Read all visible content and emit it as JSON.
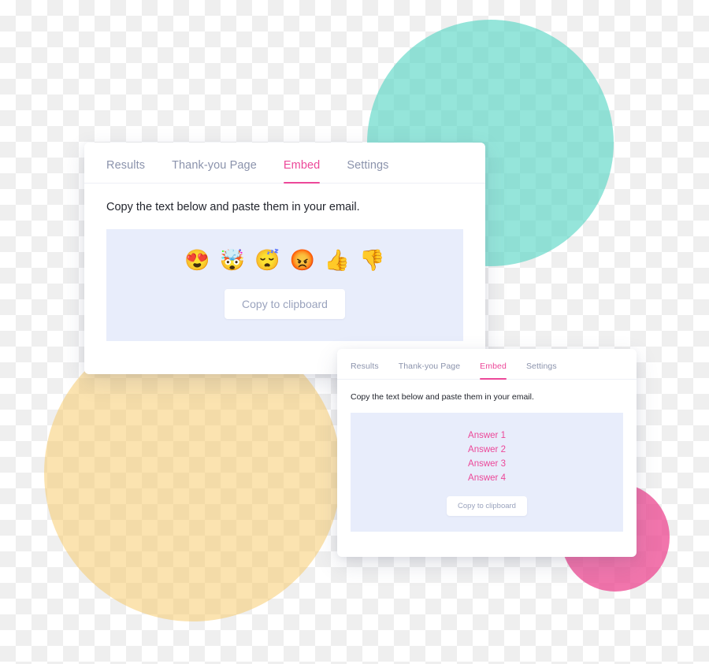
{
  "colors": {
    "accent_pink": "#ec4899",
    "tab_inactive": "#8b93ac",
    "panel_bg": "#e8edfb",
    "circle_teal": "#54d5c4",
    "circle_yellow": "#f8c968",
    "circle_pink": "#ec408c",
    "button_text": "#9aa3bd",
    "body_text": "#22252d",
    "card_bg": "#ffffff",
    "checker_light": "#ffffff",
    "checker_dark": "#efefef"
  },
  "cards": [
    {
      "id": "emoji-embed-card",
      "tabs": [
        {
          "label": "Results",
          "active": false
        },
        {
          "label": "Thank-you Page",
          "active": false
        },
        {
          "label": "Embed",
          "active": true
        },
        {
          "label": "Settings",
          "active": false
        }
      ],
      "instruction": "Copy the text below and paste them in your email.",
      "panel": {
        "variant": "emoji",
        "emojis": [
          {
            "name": "heart-eyes-emoji",
            "glyph": "😍"
          },
          {
            "name": "exploding-head-emoji",
            "glyph": "🤯"
          },
          {
            "name": "sleeping-face-emoji",
            "glyph": "😴"
          },
          {
            "name": "angry-face-emoji",
            "glyph": "😡"
          },
          {
            "name": "thumbs-up-emoji",
            "glyph": "👍"
          },
          {
            "name": "thumbs-down-emoji",
            "glyph": "👎"
          }
        ],
        "copy_button_label": "Copy to clipboard"
      }
    },
    {
      "id": "answers-embed-card",
      "tabs": [
        {
          "label": "Results",
          "active": false
        },
        {
          "label": "Thank-you Page",
          "active": false
        },
        {
          "label": "Embed",
          "active": true
        },
        {
          "label": "Settings",
          "active": false
        }
      ],
      "instruction": "Copy the text below and paste them in your email.",
      "panel": {
        "variant": "answers",
        "answers": [
          "Answer 1",
          "Answer 2",
          "Answer 3",
          "Answer 4"
        ],
        "copy_button_label": "Copy to clipboard"
      }
    }
  ]
}
